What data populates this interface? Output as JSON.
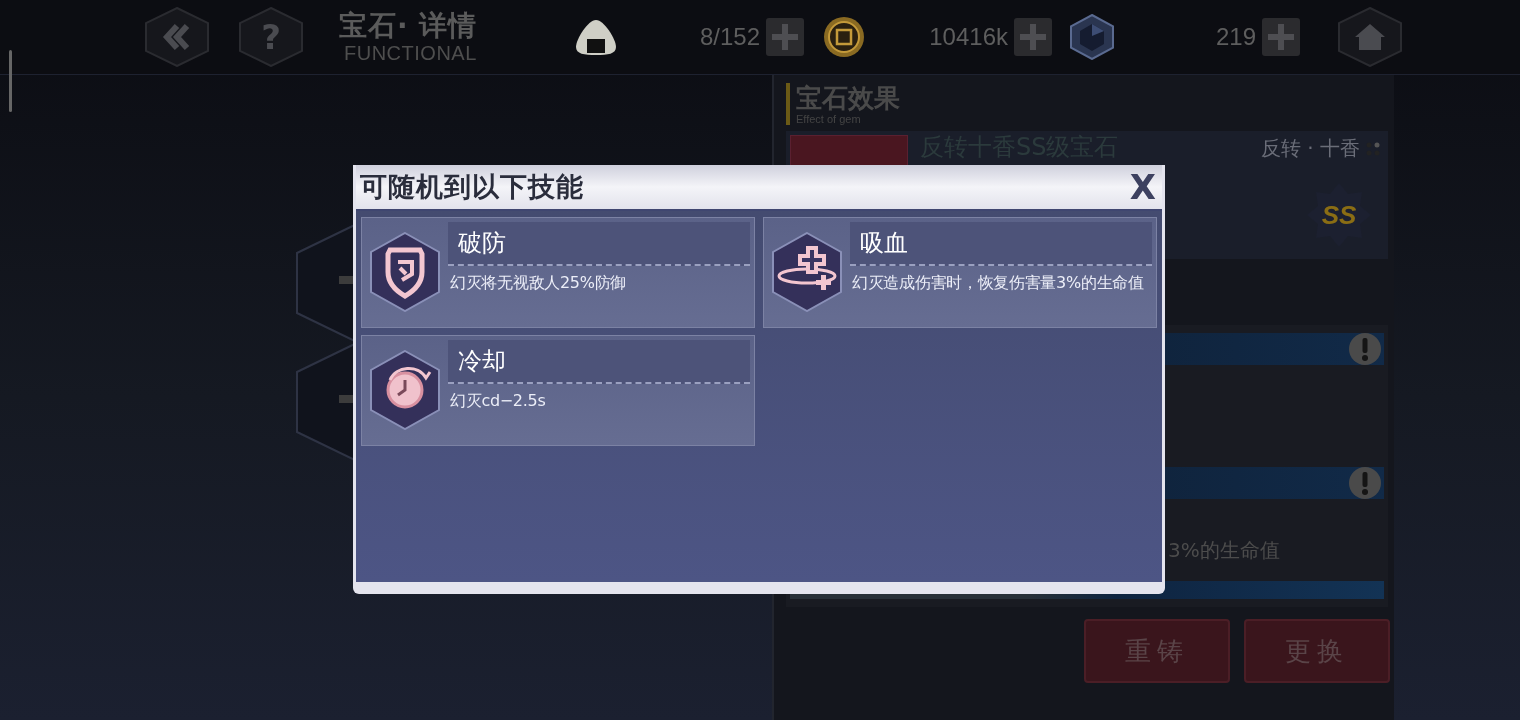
{
  "top_bar": {
    "help_label": "?",
    "title": "宝石· 详情",
    "subtitle": "FUNCTIONAL",
    "resources": [
      {
        "kind": "stamina",
        "amount": "8/152"
      },
      {
        "kind": "coin",
        "amount": "10416k"
      },
      {
        "kind": "crystal",
        "amount": "219"
      }
    ]
  },
  "effect_panel": {
    "title": "宝石效果",
    "subtitle": "Effect of gem",
    "gem": {
      "name": "反转十香SS级宝石",
      "character": "反转 · 十香",
      "rank": "SS"
    },
    "effect_text": "3%的生命值",
    "buttons": [
      "重铸",
      "更换"
    ]
  },
  "dialog": {
    "title": "可随机到以下技能",
    "close_label": "X",
    "skills": [
      {
        "kind": "armor_break",
        "name": "破防",
        "description": "幻灭将无视敌人25%防御"
      },
      {
        "kind": "lifesteal",
        "name": "吸血",
        "description": "幻灭造成伤害时，恢复伤害量3%的生命值"
      },
      {
        "kind": "cooldown",
        "name": "冷却",
        "description": "幻灭cd−2.5s"
      }
    ]
  }
}
